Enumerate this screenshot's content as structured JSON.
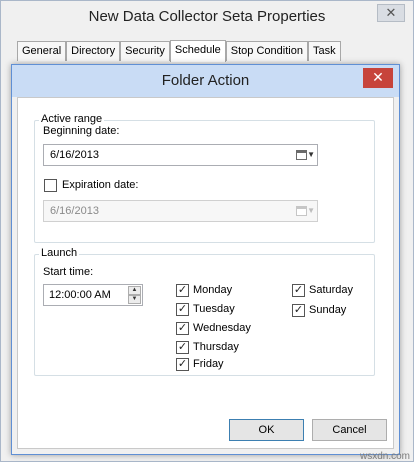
{
  "window": {
    "title": "New Data Collector Seta Properties",
    "close_label": "✕",
    "tabs": [
      {
        "label": "General"
      },
      {
        "label": "Directory"
      },
      {
        "label": "Security"
      },
      {
        "label": "Schedule"
      },
      {
        "label": "Stop Condition"
      },
      {
        "label": "Task"
      }
    ]
  },
  "dialog": {
    "title": "Folder Action",
    "close_label": "✕",
    "active_range": {
      "legend": "Active range",
      "beginning_label": "Beginning date:",
      "beginning_value": "6/16/2013",
      "expiration_label": "Expiration date:",
      "expiration_checked": false,
      "expiration_value": "6/16/2013"
    },
    "launch": {
      "legend": "Launch",
      "start_time_label": "Start time:",
      "start_time_value": "12:00:00 AM",
      "days": [
        {
          "label": "Monday",
          "checked": true
        },
        {
          "label": "Tuesday",
          "checked": true
        },
        {
          "label": "Wednesday",
          "checked": true
        },
        {
          "label": "Thursday",
          "checked": true
        },
        {
          "label": "Friday",
          "checked": true
        },
        {
          "label": "Saturday",
          "checked": true
        },
        {
          "label": "Sunday",
          "checked": true
        }
      ]
    },
    "ok_label": "OK",
    "cancel_label": "Cancel"
  },
  "watermark": "wsxdn.com",
  "glyphs": {
    "check": "✓",
    "spin_up": "▲",
    "spin_down": "▼",
    "dropdown": "▼"
  }
}
